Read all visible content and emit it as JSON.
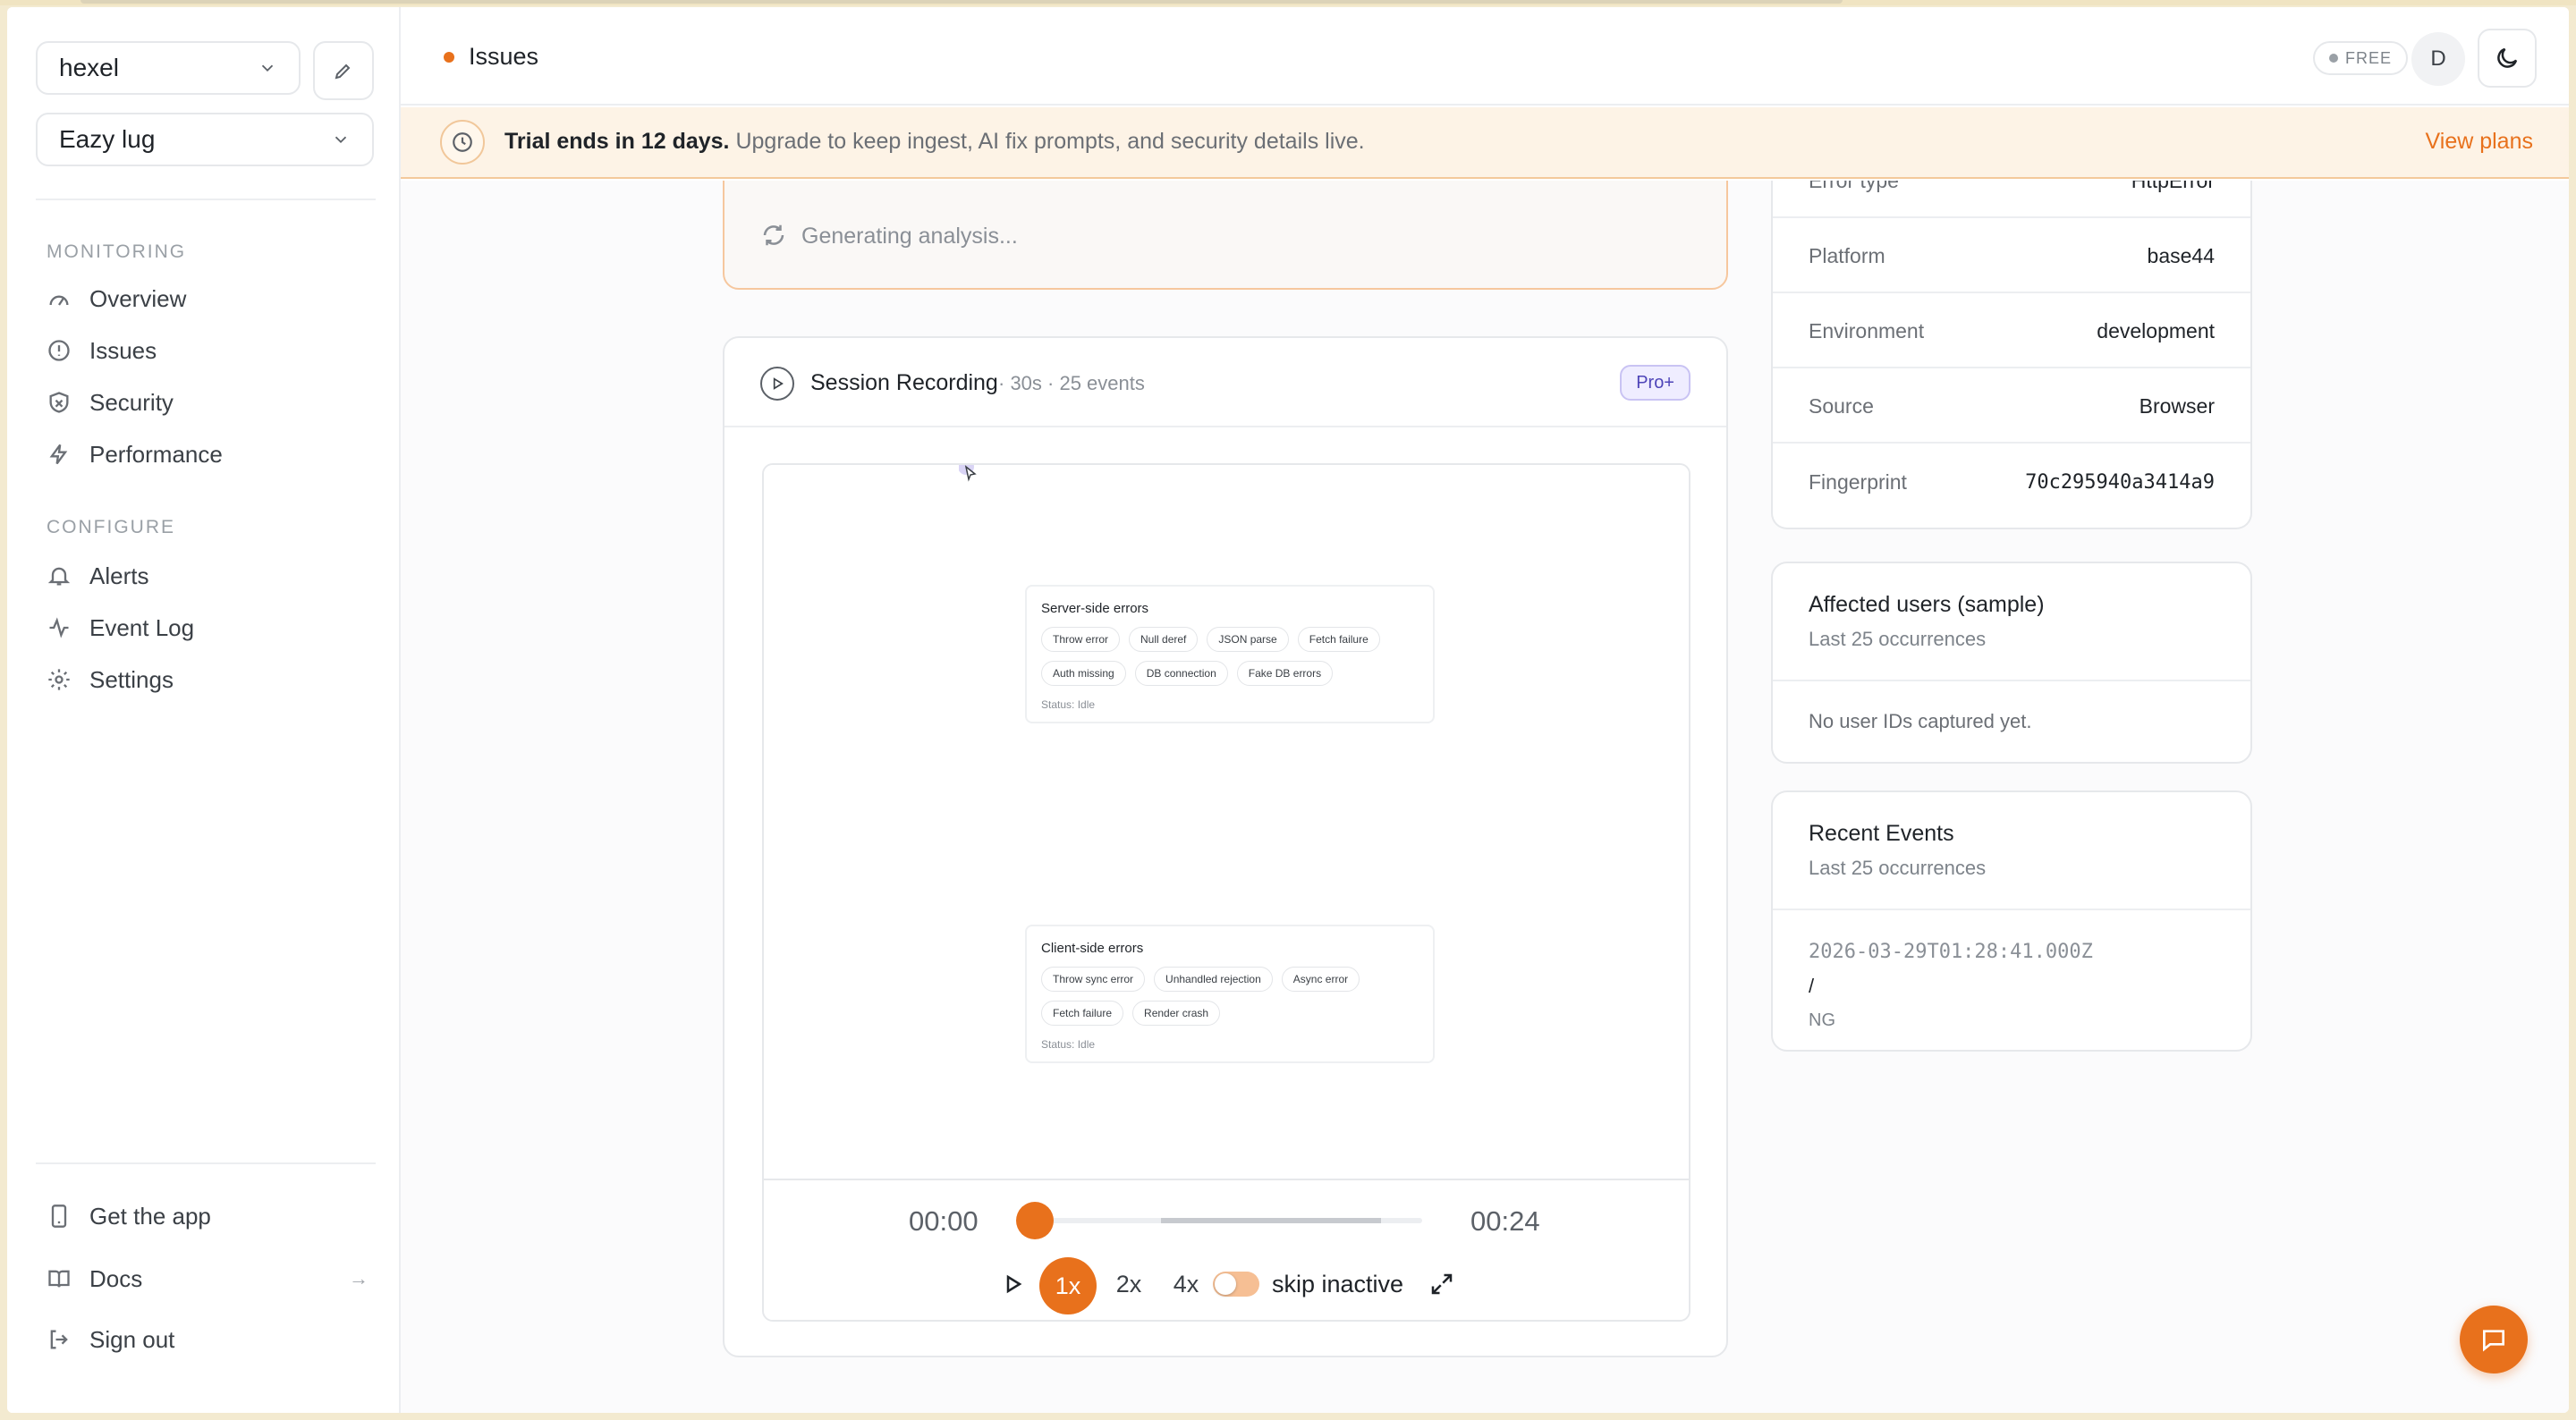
{
  "sidebar": {
    "workspace": "hexel",
    "project": "Eazy lug",
    "monitoring_label": "MONITORING",
    "configure_label": "CONFIGURE",
    "monitoring_items": [
      {
        "label": "Overview",
        "icon": "gauge-icon"
      },
      {
        "label": "Issues",
        "icon": "alert-circle-icon"
      },
      {
        "label": "Security",
        "icon": "shield-icon"
      },
      {
        "label": "Performance",
        "icon": "lightning-icon"
      }
    ],
    "configure_items": [
      {
        "label": "Alerts",
        "icon": "bell-icon"
      },
      {
        "label": "Event Log",
        "icon": "activity-icon"
      },
      {
        "label": "Settings",
        "icon": "gear-icon"
      }
    ],
    "footer_items": [
      {
        "label": "Get the app",
        "icon": "phone-icon"
      },
      {
        "label": "Docs",
        "icon": "book-icon",
        "trailing": "→"
      },
      {
        "label": "Sign out",
        "icon": "sign-out-icon"
      }
    ]
  },
  "header": {
    "title": "Issues",
    "plan_badge": "FREE",
    "avatar_initial": "D"
  },
  "banner": {
    "bold": "Trial ends in 12 days.",
    "text": " Upgrade to keep ingest, AI fix prompts, and security details live.",
    "link": "View plans"
  },
  "analysis": {
    "status": "Generating analysis..."
  },
  "recording": {
    "title": "Session Recording",
    "meta": "· 30s · 25 events",
    "badge": "Pro+",
    "server_card": {
      "title": "Server-side errors",
      "chips": [
        "Throw error",
        "Null deref",
        "JSON parse",
        "Fetch failure",
        "Auth missing",
        "DB connection",
        "Fake DB errors"
      ],
      "status": "Status: Idle"
    },
    "client_card": {
      "title": "Client-side errors",
      "chips": [
        "Throw sync error",
        "Unhandled rejection",
        "Async error",
        "Fetch failure",
        "Render crash"
      ],
      "status": "Status: Idle"
    },
    "time_current": "00:00",
    "time_total": "00:24",
    "progress": 0,
    "speeds": [
      "1x",
      "2x",
      "4x"
    ],
    "active_speed": "1x",
    "skip_label": "skip inactive"
  },
  "details": {
    "rows": [
      {
        "key": "Error type",
        "value": "HttpError"
      },
      {
        "key": "Platform",
        "value": "base44"
      },
      {
        "key": "Environment",
        "value": "development"
      },
      {
        "key": "Source",
        "value": "Browser"
      },
      {
        "key": "Fingerprint",
        "value": "70c295940a3414a9"
      }
    ]
  },
  "affected_users": {
    "title": "Affected users (sample)",
    "subtitle": "Last 25 occurrences",
    "empty": "No user IDs captured yet."
  },
  "recent_events": {
    "title": "Recent Events",
    "subtitle": "Last 25 occurrences",
    "timestamp": "2026-03-29T01:28:41.000Z",
    "path": "/",
    "country": "NG"
  },
  "colors": {
    "accent": "#e8711c",
    "banner_bg": "#fdf3e6",
    "pro_badge": "#4e45b8"
  }
}
